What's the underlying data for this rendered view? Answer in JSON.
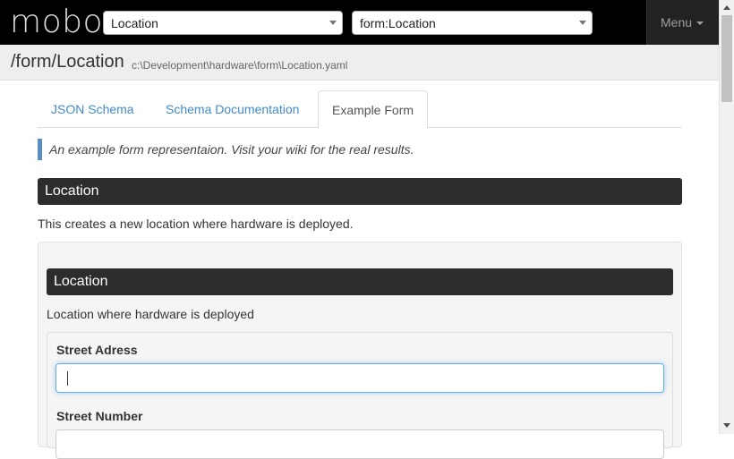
{
  "navbar": {
    "brand": "mobo",
    "select_type": {
      "value": "Location"
    },
    "select_form": {
      "value": "form:Location"
    },
    "menu_label": "Menu"
  },
  "pathbar": {
    "title": "/form/Location",
    "file": "c:\\Development\\hardware\\form\\Location.yaml"
  },
  "tabs": [
    {
      "label": "JSON Schema",
      "active": false
    },
    {
      "label": "Schema Documentation",
      "active": false
    },
    {
      "label": "Example Form",
      "active": true
    }
  ],
  "note": "An example form representaion. Visit your wiki for the real results.",
  "form": {
    "title": "Location",
    "description": "This creates a new location where hardware is deployed.",
    "section": {
      "title": "Location",
      "description": "Location where hardware is deployed",
      "fields": [
        {
          "label": "Street Adress",
          "value": ""
        },
        {
          "label": "Street Number",
          "value": ""
        }
      ]
    }
  },
  "colors": {
    "navbar": "#000000",
    "accent": "#428bca",
    "section_header": "#2d2d2d",
    "focus": "#66afe9"
  }
}
